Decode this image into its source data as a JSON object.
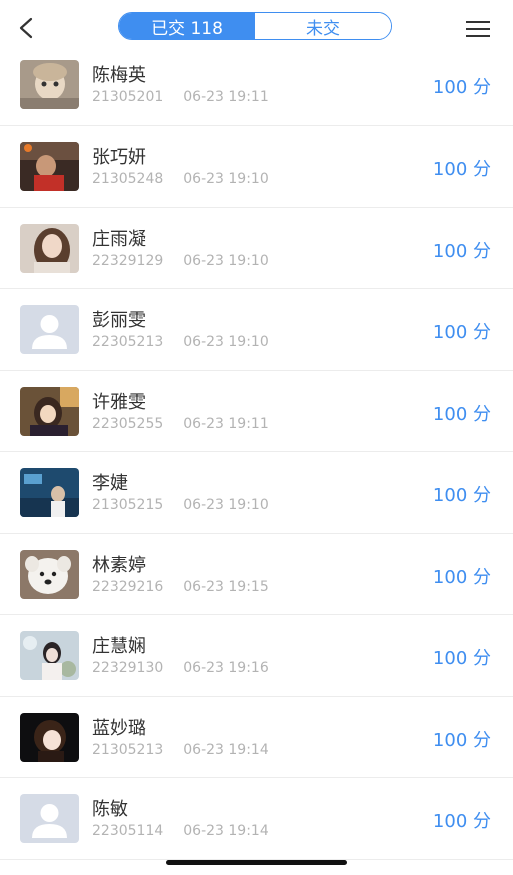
{
  "header": {
    "tabs": [
      {
        "label": "已交 118",
        "active": true
      },
      {
        "label": "未交",
        "active": false
      }
    ],
    "accent_color": "#3f8ef0"
  },
  "students": [
    {
      "name": "陈梅英",
      "id": "21305201",
      "time": "06-23 19:11",
      "score": "100 分",
      "avatar": "photo-dog-hat"
    },
    {
      "name": "张巧妍",
      "id": "21305248",
      "time": "06-23 19:10",
      "score": "100 分",
      "avatar": "photo-person-red"
    },
    {
      "name": "庄雨凝",
      "id": "22329129",
      "time": "06-23 19:10",
      "score": "100 分",
      "avatar": "photo-woman"
    },
    {
      "name": "彭丽雯",
      "id": "22305213",
      "time": "06-23 19:10",
      "score": "100 分",
      "avatar": "default-avatar"
    },
    {
      "name": "许雅雯",
      "id": "22305255",
      "time": "06-23 19:11",
      "score": "100 分",
      "avatar": "photo-anime-girl"
    },
    {
      "name": "李婕",
      "id": "21305215",
      "time": "06-23 19:10",
      "score": "100 分",
      "avatar": "photo-blue-scene"
    },
    {
      "name": "林素婷",
      "id": "22329216",
      "time": "06-23 19:15",
      "score": "100 分",
      "avatar": "photo-white-dog"
    },
    {
      "name": "庄慧娴",
      "id": "22329130",
      "time": "06-23 19:16",
      "score": "100 分",
      "avatar": "photo-flowers-girl"
    },
    {
      "name": "蓝妙璐",
      "id": "21305213",
      "time": "06-23 19:14",
      "score": "100 分",
      "avatar": "photo-anime-dark"
    },
    {
      "name": "陈敏",
      "id": "22305114",
      "time": "06-23 19:14",
      "score": "100 分",
      "avatar": "default-avatar"
    }
  ]
}
